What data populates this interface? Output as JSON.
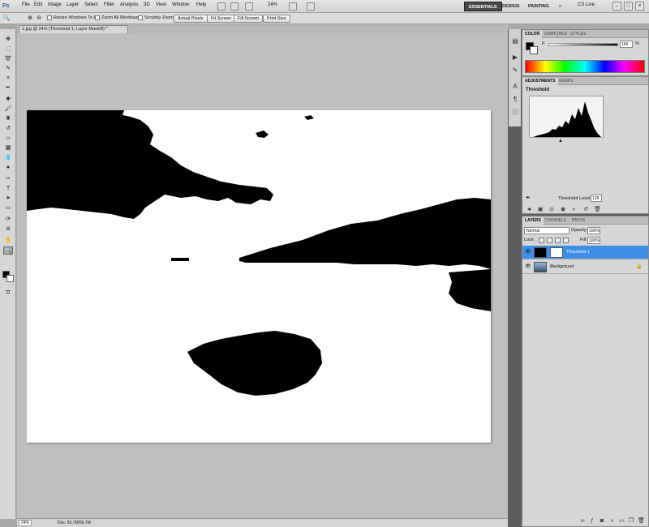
{
  "menubar": {
    "logo": "Ps",
    "items": [
      "File",
      "Edit",
      "Image",
      "Layer",
      "Select",
      "Filter",
      "Analysis",
      "3D",
      "View",
      "Window",
      "Help"
    ],
    "zoom": "24%",
    "workspaces": [
      "ESSENTIALS",
      "DESIGN",
      "PAINTING"
    ],
    "more": "»",
    "cslive": "CS Live"
  },
  "options": {
    "checks": [
      "Resize Windows To Fit",
      "Zoom All Windows",
      "Scrubby Zoom"
    ],
    "buttons": [
      "Actual Pixels",
      "Fit Screen",
      "Fill Screen",
      "Print Size"
    ]
  },
  "document": {
    "tab": "1.jpg @ 24% (Threshold 1, Layer Mask/8) *",
    "zoom_status": "24%",
    "info": "Doc: 56.7M/56.7M"
  },
  "color_panel": {
    "tabs": [
      "COLOR",
      "SWATCHES",
      "STYLES"
    ],
    "channel": "K",
    "value": "100",
    "unit": "%"
  },
  "adjustments_panel": {
    "tabs": [
      "ADJUSTMENTS",
      "MASKS"
    ],
    "title": "Threshold",
    "threshold_label": "Threshold Level:",
    "threshold_value": "128"
  },
  "layers_panel": {
    "tabs": [
      "LAYERS",
      "CHANNELS",
      "PATHS"
    ],
    "blend_mode": "Normal",
    "opacity_label": "Opacity:",
    "opacity_value": "100%",
    "lock_label": "Lock:",
    "fill_label": "Fill:",
    "fill_value": "100%",
    "layers": [
      {
        "name": "Threshold 1"
      },
      {
        "name": "Background"
      }
    ]
  },
  "colors": {
    "selection": "#3d8ee8",
    "active_workspace": "#4a4a4a"
  }
}
